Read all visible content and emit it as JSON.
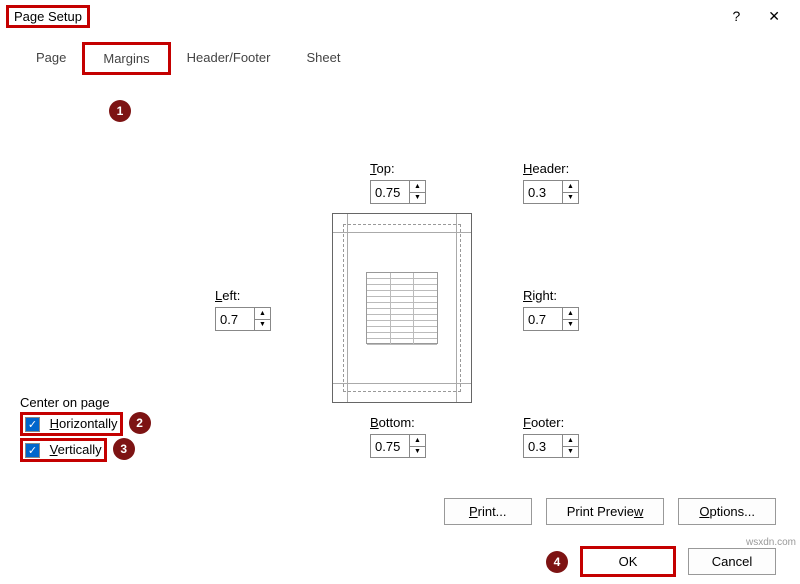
{
  "title": "Page Setup",
  "tabs": [
    "Page",
    "Margins",
    "Header/Footer",
    "Sheet"
  ],
  "active_tab_index": 1,
  "margins": {
    "top": {
      "label": "Top:",
      "letter": "T",
      "value": "0.75"
    },
    "header": {
      "label": "Header:",
      "letter": "H",
      "value": "0.3"
    },
    "left": {
      "label": "Left:",
      "letter": "L",
      "value": "0.7"
    },
    "right": {
      "label": "Right:",
      "letter": "R",
      "value": "0.7"
    },
    "bottom": {
      "label": "Bottom:",
      "letter": "B",
      "value": "0.75"
    },
    "footer": {
      "label": "Footer:",
      "letter": "F",
      "value": "0.3"
    }
  },
  "center": {
    "section_label": "Center on page",
    "horizontally": {
      "label": "Horizontally",
      "letter": "H",
      "checked": true
    },
    "vertically": {
      "label": "Vertically",
      "letter": "V",
      "checked": true
    }
  },
  "buttons": {
    "print": "Print...",
    "print_letter": "P",
    "preview": "Print Preview",
    "preview_letter": "w",
    "options": "Options...",
    "options_letter": "O",
    "ok": "OK",
    "cancel": "Cancel"
  },
  "badges": {
    "b1": "1",
    "b2": "2",
    "b3": "3",
    "b4": "4"
  },
  "watermark": "wsxdn.com"
}
